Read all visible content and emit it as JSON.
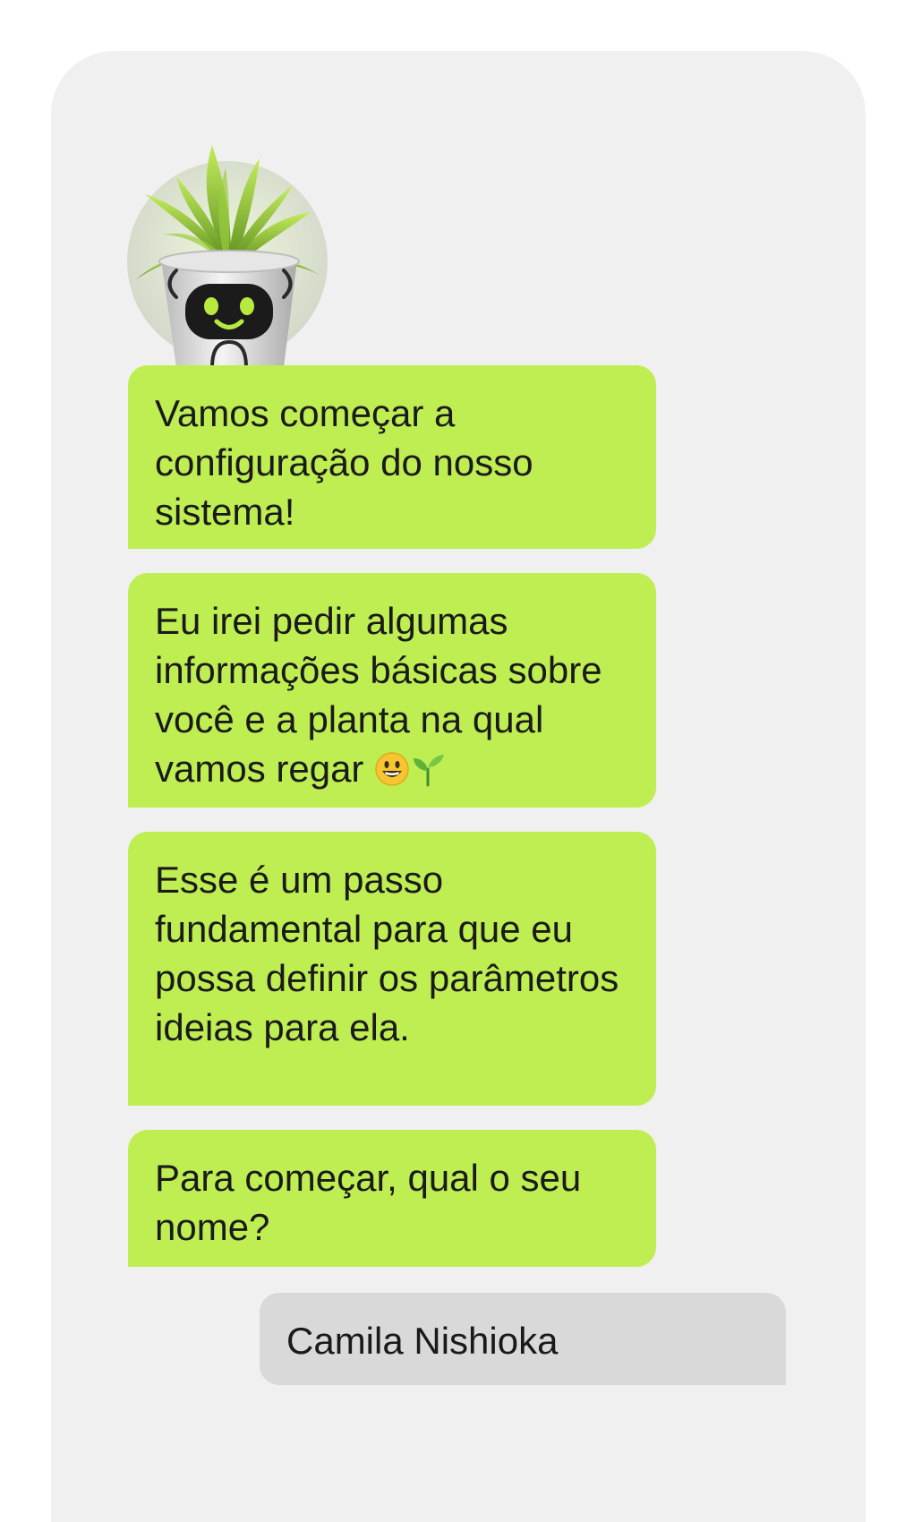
{
  "chat": {
    "bot_avatar": "plant-robot-avatar",
    "messages": [
      {
        "sender": "bot",
        "text": "Vamos começar a configuração do nosso sistema!"
      },
      {
        "sender": "bot",
        "text": "Eu irei pedir algumas informações básicas sobre você e a planta na qual vamos regar",
        "emoji": [
          "smiley-icon",
          "seedling-icon"
        ]
      },
      {
        "sender": "bot",
        "text": "Esse é um passo fundamental para que eu possa definir os parâmetros ideias para ela."
      },
      {
        "sender": "bot",
        "text": "Para começar, qual o seu nome?"
      },
      {
        "sender": "user",
        "text": "Camila Nishioka"
      }
    ]
  },
  "colors": {
    "panel_bg": "#f0f0f0",
    "bot_bubble": "#bfee52",
    "user_bubble": "#d9d9d9",
    "text": "#1a1a1a"
  }
}
